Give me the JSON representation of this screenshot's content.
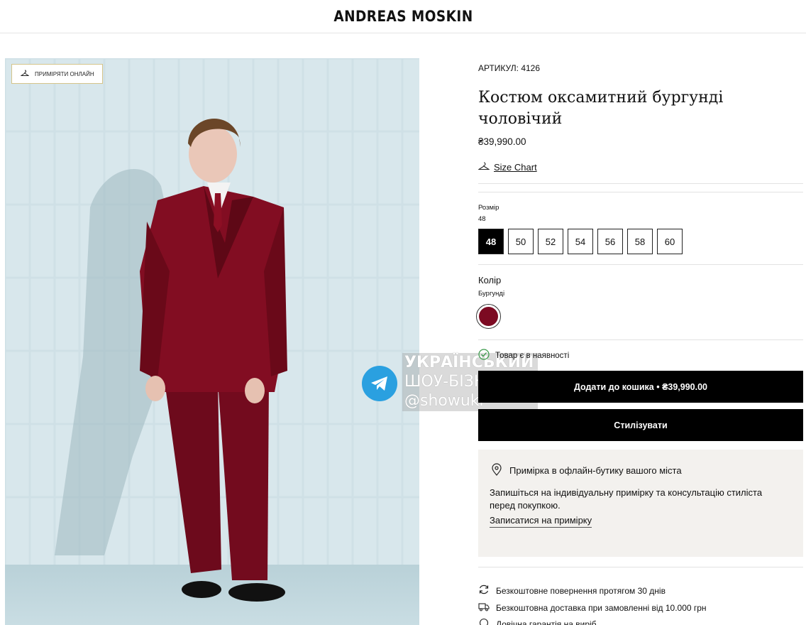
{
  "header": {
    "brand": "ANDREAS MOSKIN"
  },
  "gallery": {
    "try_on_label": "ПРИМІРЯТИ ОНЛАЙН",
    "watermark_lines": [
      "УКРАЇНСЬКИЙ",
      "ШОУ-БІЗНЕС",
      "@showukr"
    ]
  },
  "product": {
    "sku": "АРТИКУЛ: 4126",
    "title": "Костюм оксамитний бургунді чоловічий",
    "price": "₴39,990.00",
    "size_chart_label": "Size Chart",
    "size_label": "Розмір",
    "selected_size": "48",
    "sizes": [
      "48",
      "50",
      "52",
      "54",
      "56",
      "58",
      "60"
    ],
    "color_label": "Колір",
    "color_name": "Бургунді",
    "color_hex": "#7c0a22",
    "stock_status": "Товар є в наявності",
    "add_to_cart_label": "Додати до кошика • ₴39,990.00",
    "stylize_label": "Стилізувати"
  },
  "fitting": {
    "title": "Примірка в офлайн-бутику вашого міста",
    "description": "Запишіться на індивідуальну примірку та консультацію стиліста перед покупкою.",
    "link_label": "Записатися на примірку"
  },
  "benefits": [
    {
      "icon": "return-icon",
      "text": "Безкоштовне повернення протягом 30 днів"
    },
    {
      "icon": "truck-icon",
      "text": "Безкоштовна доставка при замовленні від 10.000 грн"
    },
    {
      "icon": "warranty-icon",
      "text": "Довічна гарантія на виріб"
    }
  ],
  "colors": {
    "accent": "#000000",
    "burgundy": "#7c0a22",
    "telegram": "#2aa0e0",
    "fitting_bg": "#f3f1ee"
  }
}
